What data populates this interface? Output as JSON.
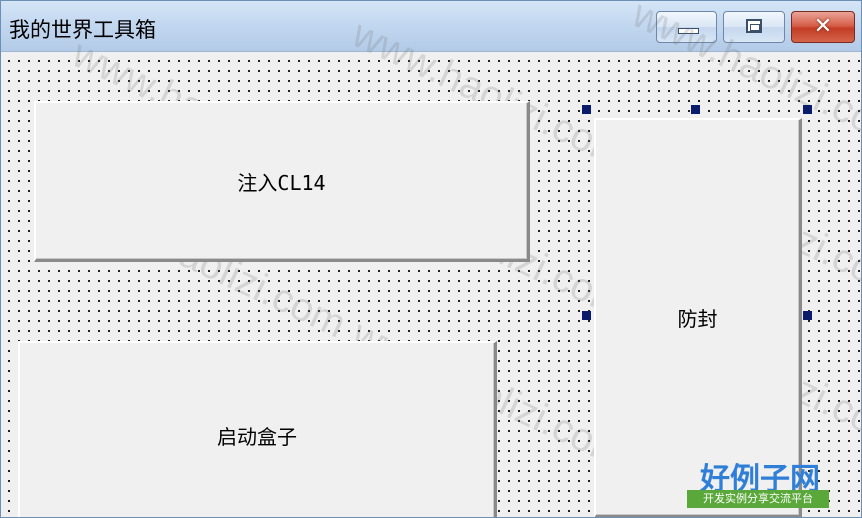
{
  "window": {
    "title": "我的世界工具箱",
    "controls": {
      "minimize": "minimize-icon",
      "maximize": "maximize-icon",
      "close": "close-icon",
      "close_glyph": "✕"
    }
  },
  "buttons": {
    "inject_label": "注入CL14",
    "box_label": "启动盒子",
    "anti_ban_label": "防封"
  },
  "watermark": {
    "text": "www.haolizi.com"
  },
  "logo": {
    "main": "好例子网",
    "sub": "开发实例分享交流平台"
  },
  "colors": {
    "selection_handle": "#0b1b6b",
    "close_button": "#c43c25",
    "titlebar": "#c3d8f0"
  }
}
